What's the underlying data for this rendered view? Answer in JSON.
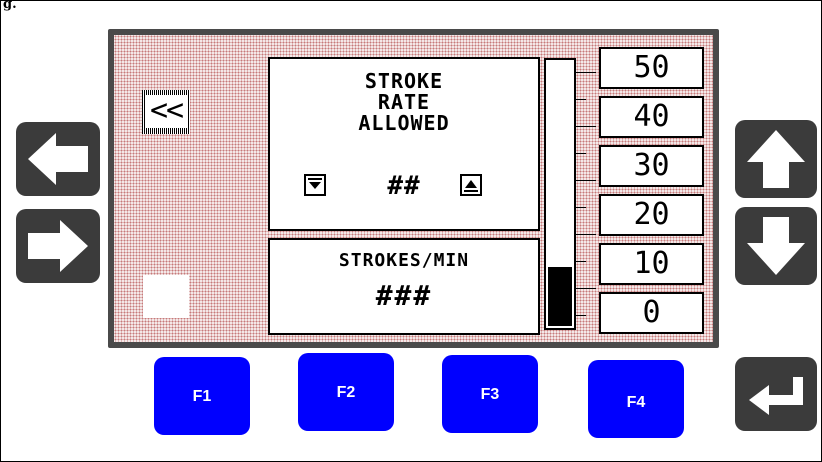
{
  "figure_label": "g.",
  "back_button": {
    "label": "<<"
  },
  "main_panel": {
    "title_lines": [
      "STROKE",
      "RATE",
      "ALLOWED"
    ],
    "value": "##",
    "decrement_icon": "triangle-down-icon",
    "increment_icon": "triangle-up-icon"
  },
  "units_panel": {
    "units": "STROKES/MIN",
    "value": "###"
  },
  "bar_gauge": {
    "level_percent": 22
  },
  "scale_labels": [
    "50",
    "40",
    "30",
    "20",
    "10",
    "0"
  ],
  "nav_keys": {
    "left": "arrow-left-icon",
    "right": "arrow-right-icon",
    "up": "arrow-up-icon",
    "down": "arrow-down-icon",
    "enter": "enter-icon"
  },
  "function_keys": [
    "F1",
    "F2",
    "F3",
    "F4"
  ],
  "colors": {
    "function_key": "#0000ff",
    "hardware_key": "#3b3b3b",
    "lcd_dot": "#c77a7a"
  }
}
